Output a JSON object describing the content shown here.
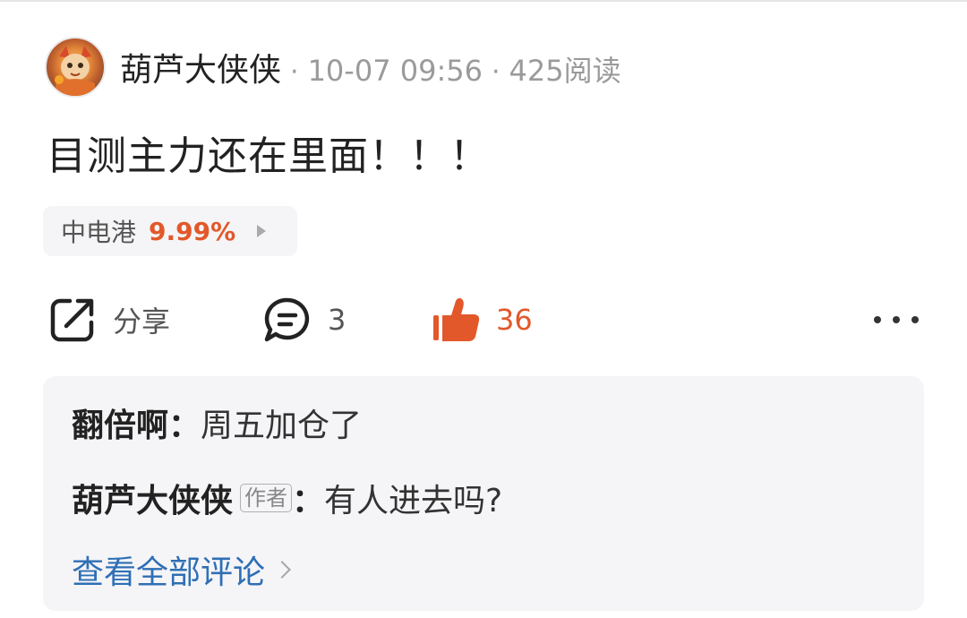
{
  "post": {
    "author": "葫芦大侠侠",
    "time": "10-07 09:56",
    "reads": "425阅读",
    "separator": "·",
    "content": "目测主力还在里面！！！"
  },
  "stock": {
    "name": "中电港",
    "change": "9.99%",
    "change_color": "#e2582a"
  },
  "actions": {
    "share_label": "分享",
    "share_icon": "share-icon",
    "comment_count": "3",
    "comment_icon": "comment-icon",
    "like_count": "36",
    "like_icon": "thumbs-up-icon",
    "like_color": "#e2582a",
    "more_icon": "more-icon"
  },
  "comments": {
    "items": [
      {
        "author": "翻倍啊",
        "colon": "：",
        "text": "周五加仓了"
      },
      {
        "author": "葫芦大侠侠",
        "badge": "作者",
        "colon": "：",
        "text": "有人进去吗?"
      }
    ],
    "view_all": "查看全部评论",
    "link_color": "#2f6fb5"
  }
}
